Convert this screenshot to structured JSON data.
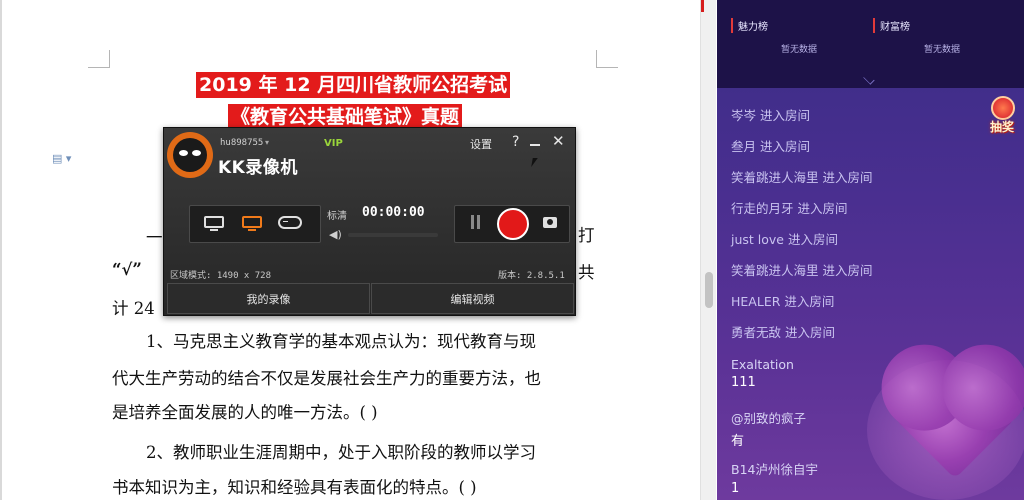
{
  "document": {
    "title_line1": "2019 年 12 月四川省教师公招考试",
    "title_line2": "《教育公共基础笔试》真题",
    "fragment_pre": "一",
    "fragment_right1": "打",
    "fragment_quote": "“√”",
    "fragment_right2": "共",
    "fragment_count": "计 24",
    "line1": "1、马克思主义教育学的基本观点认为：现代教育与现",
    "line2": "代大生产劳动的结合不仅是发展社会生产力的重要方法，也",
    "line3": "是培养全面发展的人的唯一方法。( )",
    "line4": "2、教师职业生涯周期中，处于入职阶段的教师以学习",
    "line5": "书本知识为主，知识和经验具有表面化的特点。( )"
  },
  "recorder": {
    "username": "hu898755",
    "vip": "VIP",
    "title": "KK录像机",
    "settings": "设置",
    "help": "?",
    "close": "✕",
    "quality": "标清",
    "timer": "00:00:00",
    "volume_icon": "◀)",
    "region_mode": "区域模式: 1490 x 728",
    "version": "版本: 2.8.5.1",
    "my_recordings": "我的录像",
    "edit_video": "编辑视频",
    "accent_color": "#f07a1a",
    "record_color": "#e21919"
  },
  "chat": {
    "rank_charm": "魅力榜",
    "rank_wealth": "财富榜",
    "empty_charm": "暂无数据",
    "empty_wealth": "暂无数据",
    "lottery": "抽奖",
    "entries": [
      {
        "name": "岑岑",
        "action": "进入房间"
      },
      {
        "name": "叁月",
        "action": "进入房间"
      },
      {
        "name": "笑着跳进人海里",
        "action": "进入房间"
      },
      {
        "name": "行走的月牙",
        "action": "进入房间"
      },
      {
        "name": "just love",
        "action": "进入房间"
      },
      {
        "name": "笑着跳进人海里",
        "action": "进入房间"
      },
      {
        "name": "HEALER",
        "action": "进入房间"
      },
      {
        "name": "勇者无敌",
        "action": "进入房间"
      }
    ],
    "comments": [
      {
        "name": "Exaltation",
        "text": "111"
      },
      {
        "name": "@别致的疯子",
        "text": "有"
      },
      {
        "name": "B14泸州徐自宇",
        "text": "1"
      }
    ]
  }
}
